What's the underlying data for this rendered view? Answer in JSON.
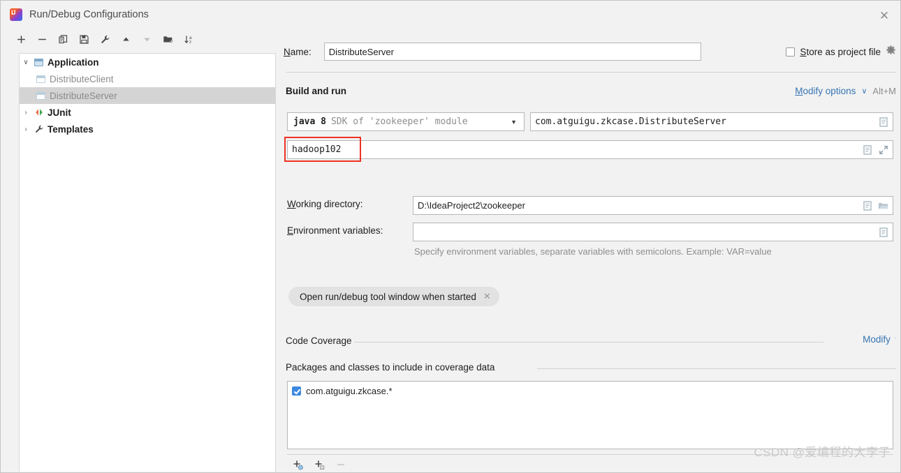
{
  "window": {
    "title": "Run/Debug Configurations",
    "app_icon": "intellij-idea-icon",
    "close_label": "✕"
  },
  "toolbar": {
    "items": [
      {
        "name": "add-configuration-button",
        "glyph": "+",
        "disabled": false
      },
      {
        "name": "remove-configuration-button",
        "glyph": "−",
        "disabled": false
      },
      {
        "name": "copy-configuration-button",
        "glyph": "copy-icon",
        "disabled": false
      },
      {
        "name": "save-configuration-button",
        "glyph": "save-icon",
        "disabled": false
      },
      {
        "name": "edit-templates-button",
        "glyph": "wrench-icon",
        "disabled": false
      },
      {
        "name": "move-up-button",
        "glyph": "▲",
        "disabled": false
      },
      {
        "name": "move-down-button",
        "glyph": "▼",
        "disabled": true
      },
      {
        "name": "move-into-folder-button",
        "glyph": "folder-add-icon",
        "disabled": false
      },
      {
        "name": "sort-configurations-button",
        "glyph": "sort-az-icon",
        "disabled": false
      }
    ]
  },
  "tree": {
    "nodes": [
      {
        "label": "Application",
        "icon": "application-icon",
        "expanded": true,
        "bold": true,
        "level": 0,
        "selected": false,
        "muted": false,
        "twisty": "∨"
      },
      {
        "label": "DistributeClient",
        "icon": "application-config-icon",
        "expanded": null,
        "bold": false,
        "level": 1,
        "selected": false,
        "muted": true,
        "twisty": ""
      },
      {
        "label": "DistributeServer",
        "icon": "application-config-icon",
        "expanded": null,
        "bold": false,
        "level": 1,
        "selected": true,
        "muted": true,
        "twisty": ""
      },
      {
        "label": "JUnit",
        "icon": "junit-icon",
        "expanded": false,
        "bold": true,
        "level": 0,
        "selected": false,
        "muted": false,
        "twisty": "›"
      },
      {
        "label": "Templates",
        "icon": "wrench-icon",
        "expanded": false,
        "bold": true,
        "level": 0,
        "selected": false,
        "muted": false,
        "twisty": "›"
      }
    ]
  },
  "form": {
    "name_label": "Name:",
    "name_label_mnemonic": "N",
    "name_value": "DistributeServer",
    "store_as_project_file_label": "Store as project file",
    "store_as_project_file_mnemonic": "S",
    "store_as_project_file_checked": false,
    "store_gear_icon": "gear-dropdown-icon",
    "build_and_run_title": "Build and run",
    "modify_options_label": "Modify options",
    "modify_options_mnemonic": "M",
    "modify_options_shortcut": "Alt+M",
    "modify_options_chevron": "∨",
    "jdk_main": "java 8",
    "jdk_detail": "SDK of 'zookeeper' module",
    "jdk_arrow": "▼",
    "main_class_value": "com.atguigu.zkcase.DistributeServer",
    "main_class_icon": "expand-list-icon",
    "program_arguments_value": "hadoop102",
    "program_arguments_icons": [
      "expand-list-icon",
      "expand-editor-icon"
    ],
    "highlight_color": "#ee3124",
    "working_directory_label": "Working directory:",
    "working_directory_mnemonic": "W",
    "working_directory_value": "D:\\IdeaProject2\\zookeeper",
    "working_directory_icons": [
      "expand-list-icon",
      "folder-open-icon"
    ],
    "environment_variables_label": "Environment variables:",
    "environment_variables_mnemonic": "E",
    "environment_variables_value": "",
    "environment_variables_icons": [
      "expand-list-icon"
    ],
    "environment_variables_hint": "Specify environment variables, separate variables with semicolons. Example: VAR=value",
    "option_chip_label": "Open run/debug tool window when started",
    "option_chip_close": "✕",
    "code_coverage_title": "Code Coverage",
    "code_coverage_modify_label": "Modify",
    "code_coverage_modify_chevron": "∨",
    "packages_header": "Packages and classes to include in coverage data",
    "coverage_items": [
      {
        "label": "com.atguigu.zkcase.*",
        "checked": true
      }
    ],
    "coverage_toolbar": [
      {
        "name": "add-package-button",
        "glyph": "+",
        "disabled": false
      },
      {
        "name": "add-class-button",
        "glyph": "+",
        "disabled": false
      },
      {
        "name": "remove-coverage-entry-button",
        "glyph": "−",
        "disabled": true
      }
    ]
  },
  "watermark": {
    "text": "CSDN @爱编程的大李子"
  }
}
